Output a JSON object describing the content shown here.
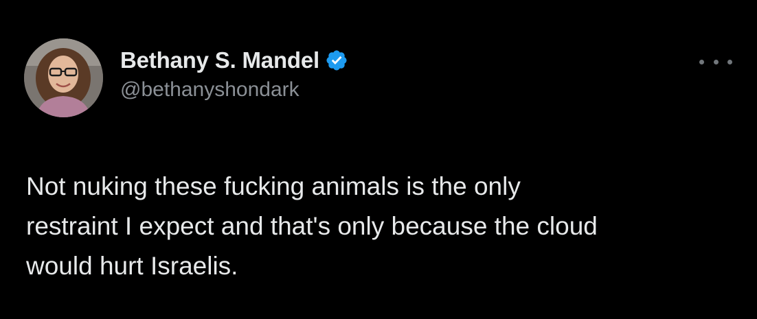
{
  "tweet": {
    "author": {
      "display_name": "Bethany S. Mandel",
      "handle": "@bethanyshondark",
      "verified": true,
      "verified_icon": "verified-badge-icon",
      "avatar_icon": "profile-photo"
    },
    "text_lines": [
      "Not nuking these fucking animals is the only",
      "restraint I expect and that's only because the cloud",
      "would hurt Israelis."
    ],
    "more_icon": "more-options-icon"
  },
  "colors": {
    "background": "#000000",
    "text_primary": "#e7e9ea",
    "text_secondary": "#8b9096",
    "verified_blue": "#1d9bf0"
  }
}
